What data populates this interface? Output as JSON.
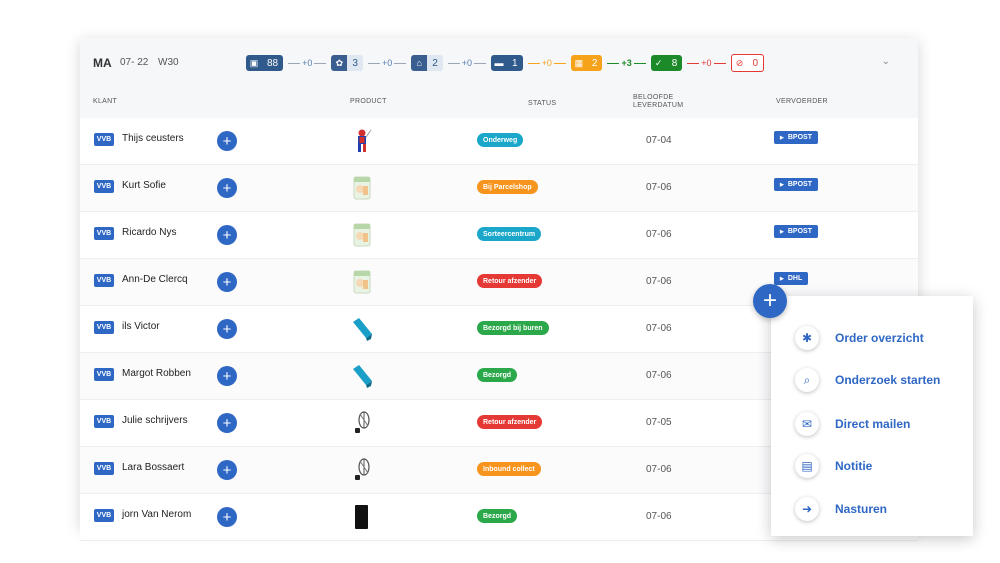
{
  "header": {
    "day": "MA",
    "date": "07- 22",
    "week": "W30",
    "pipeline": [
      {
        "kind": "stage",
        "style": "st-blue",
        "icon": "warehouse-icon",
        "glyph": "▣",
        "count": "88"
      },
      {
        "kind": "conn",
        "style": "blue",
        "delta": "+0"
      },
      {
        "kind": "stage",
        "style": "st-blue2",
        "icon": "gear-icon",
        "glyph": "✿",
        "count": "3"
      },
      {
        "kind": "conn",
        "style": "blue",
        "delta": "+0"
      },
      {
        "kind": "stage",
        "style": "st-blue2",
        "icon": "depot-icon",
        "glyph": "⌂",
        "count": "2"
      },
      {
        "kind": "conn",
        "style": "blue",
        "delta": "+0"
      },
      {
        "kind": "stage",
        "style": "st-blue",
        "icon": "truck-icon",
        "glyph": "▬",
        "count": "1"
      },
      {
        "kind": "conn",
        "style": "orange",
        "delta": "+0"
      },
      {
        "kind": "stage",
        "style": "st-orange",
        "icon": "parcel-icon",
        "glyph": "▦",
        "count": "2"
      },
      {
        "kind": "conn",
        "style": "green",
        "delta": "+3"
      },
      {
        "kind": "stage",
        "style": "st-green",
        "icon": "thumbs-up-icon",
        "glyph": "✓",
        "count": "8"
      },
      {
        "kind": "conn",
        "style": "red",
        "delta": "+0"
      },
      {
        "kind": "stage",
        "style": "st-red",
        "icon": "alert-icon",
        "glyph": "⊘",
        "count": "0"
      }
    ],
    "collapse_glyph": "⌄"
  },
  "columns": {
    "klant": "KLANT",
    "product": "PRODUCT",
    "status": "STATUS",
    "beloofde": "BELOOFDE",
    "leverdatum": "LEVERDATUM",
    "vervoerder": "VERVOERDER"
  },
  "rows": [
    {
      "tag": "VVB",
      "name": "Thijs ceusters",
      "product": "spiderman-figure",
      "status": "Onderweg",
      "status_color": "#1aa7c9",
      "date": "07-04",
      "carrier": "BPOST"
    },
    {
      "tag": "VVB",
      "name": "Kurt Sofie",
      "product": "diaper-pack",
      "status": "Bij Parcelshop",
      "status_color": "#f7941d",
      "date": "07-06",
      "carrier": "BPOST"
    },
    {
      "tag": "VVB",
      "name": "Ricardo Nys",
      "product": "diaper-pack",
      "status": "Sorteercentrum",
      "status_color": "#1aa7c9",
      "date": "07-06",
      "carrier": "BPOST"
    },
    {
      "tag": "VVB",
      "name": "Ann-De Clercq",
      "product": "diaper-pack",
      "status": "Retour afzender",
      "status_color": "#e53935",
      "date": "07-06",
      "carrier": "DHL"
    },
    {
      "tag": "VVB",
      "name": "ils Victor",
      "product": "yoga-mat",
      "status": "Bezorgd bij buren",
      "status_color": "#2aa84a",
      "date": "07-06",
      "carrier": ""
    },
    {
      "tag": "VVB",
      "name": "Margot Robben",
      "product": "yoga-mat",
      "status": "Bezorgd",
      "status_color": "#2aa84a",
      "date": "07-06",
      "carrier": ""
    },
    {
      "tag": "VVB",
      "name": "Julie schrijvers",
      "product": "whisk",
      "status": "Retour afzender",
      "status_color": "#e53935",
      "date": "07-05",
      "carrier": ""
    },
    {
      "tag": "VVB",
      "name": "Lara Bossaert",
      "product": "whisk",
      "status": "Inbound collect",
      "status_color": "#f7941d",
      "date": "07-06",
      "carrier": ""
    },
    {
      "tag": "VVB",
      "name": "jorn Van Nerom",
      "product": "black-case",
      "status": "Bezorgd",
      "status_color": "#2aa84a",
      "date": "07-06",
      "carrier": ""
    }
  ],
  "fab_glyph": "+",
  "row_plus_glyph": "+",
  "menu": [
    {
      "label": "Order overzicht",
      "icon": "hub-icon",
      "glyph": "✱"
    },
    {
      "label": "Onderzoek starten",
      "icon": "magnify-icon",
      "glyph": "⌕"
    },
    {
      "label": "Direct mailen",
      "icon": "mail-icon",
      "glyph": "✉"
    },
    {
      "label": "Notitie",
      "icon": "note-icon",
      "glyph": "▤"
    },
    {
      "label": "Nasturen",
      "icon": "forward-icon",
      "glyph": "➜"
    }
  ]
}
